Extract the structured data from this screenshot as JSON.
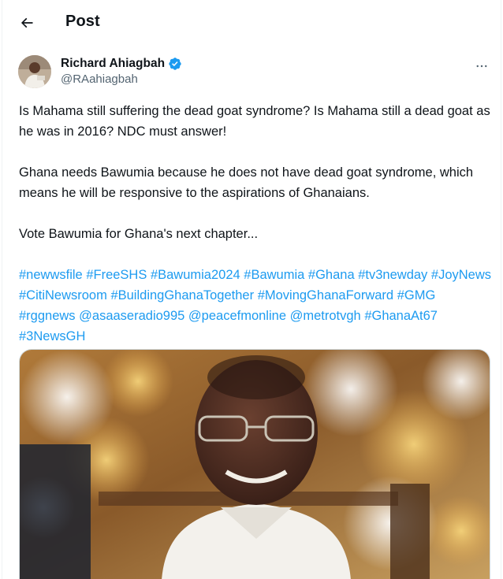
{
  "header": {
    "title": "Post"
  },
  "author": {
    "name": "Richard Ahiagbah",
    "handle": "@RAahiagbah",
    "verified": true
  },
  "tweet": {
    "paragraphs": [
      "Is Mahama still suffering the dead goat syndrome? Is Mahama still a dead goat as he was in 2016? NDC must answer!",
      "Ghana needs Bawumia because he does not have dead goat syndrome, which means he will be responsive to the aspirations of Ghanaians.",
      "Vote Bawumia for Ghana's next chapter..."
    ],
    "tags": [
      "#newwsfile",
      "#FreeSHS",
      "#Bawumia2024",
      "#Bawumia",
      "#Ghana",
      "#tv3newday",
      "#JoyNews",
      "#CitiNewsroom",
      "#BuildingGhanaTogether",
      "#MovingGhanaForward",
      "#GMG",
      "#rggnews",
      "@asaaseradio995",
      "@peacefmonline",
      "@metrotvgh",
      "#GhanaAt67",
      "#3NewsGH"
    ]
  },
  "icons": {
    "back": "back-arrow-icon",
    "verified": "verified-badge-icon",
    "more": "more-options-icon"
  },
  "colors": {
    "link": "#1d9bf0",
    "secondary_text": "#536471",
    "primary_text": "#0f1419"
  }
}
